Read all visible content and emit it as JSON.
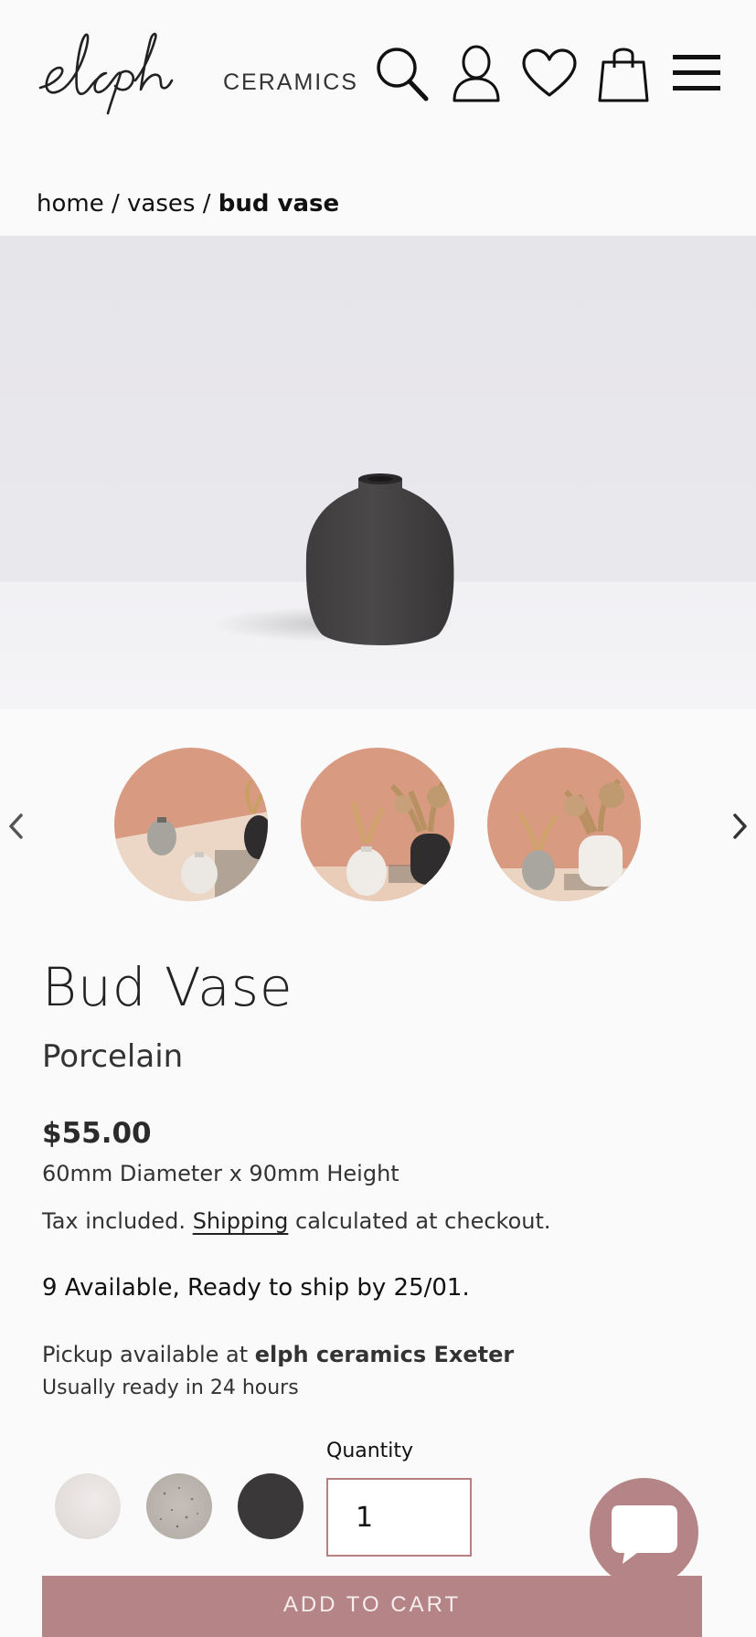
{
  "header": {
    "logo_text": "elph",
    "logo_sub": "CERAMICS",
    "icons": [
      "search-icon",
      "account-icon",
      "wishlist-heart-icon",
      "cart-bag-icon",
      "menu-hamburger-icon"
    ]
  },
  "breadcrumb": {
    "items": [
      "home",
      "vases"
    ],
    "separator": "/",
    "current": "bud vase"
  },
  "gallery": {
    "main_image": "charcoal bud vase on white surface",
    "thumbnails": [
      "vases-with-dried-flowers-1",
      "vases-with-dried-flowers-2",
      "vases-with-dried-flowers-3"
    ],
    "prev_icon": "chevron-left-icon",
    "next_icon": "chevron-right-icon"
  },
  "product": {
    "title": "Bud Vase",
    "subtitle": "Porcelain",
    "price": "$55.00",
    "dimensions": "60mm Diameter x 90mm Height",
    "tax_prefix": "Tax included.",
    "shipping_link": "Shipping",
    "tax_suffix": "calculated at checkout.",
    "availability": "9 Available, Ready to ship by 25/01.",
    "pickup_prefix": "Pickup available at",
    "pickup_location": "elph ceramics Exeter",
    "pickup_time": "Usually ready in 24 hours"
  },
  "variants": {
    "swatches": [
      {
        "name": "white",
        "color": "#e4e0df"
      },
      {
        "name": "speckled",
        "color": "#bdb8b2"
      },
      {
        "name": "charcoal",
        "color": "#3a3839"
      }
    ]
  },
  "quantity": {
    "label": "Quantity",
    "value": "1"
  },
  "actions": {
    "add_to_cart": "ADD TO CART"
  },
  "colors": {
    "accent": "#b48486",
    "background": "#fafafa",
    "text": "#222222"
  }
}
